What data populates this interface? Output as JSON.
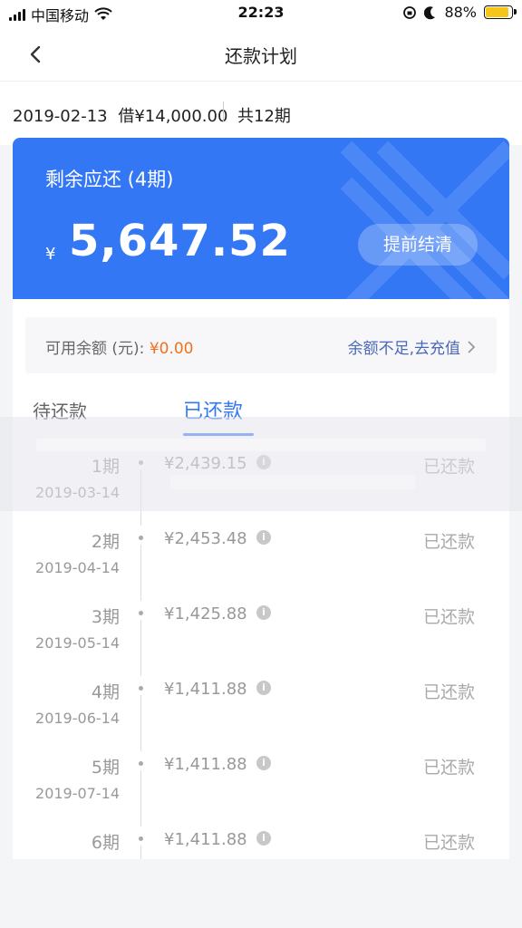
{
  "status_bar": {
    "carrier": "中国移动",
    "time": "22:23",
    "battery": "88%",
    "battery_level": 0.88,
    "icons": [
      "signal-icon",
      "wifi-icon",
      "rotation-lock-icon",
      "moon-icon",
      "battery-icon"
    ]
  },
  "nav": {
    "title": "还款计划",
    "back_icon": "chevron-left-icon"
  },
  "loan": {
    "date": "2019-02-13",
    "borrow": "借¥14,000.00",
    "total_periods": "共12期"
  },
  "card": {
    "remaining_label": "剩余应还 (4期)",
    "currency": "¥",
    "amount": "5,647.52",
    "prepay_button": "提前结清",
    "color": "#3477f5"
  },
  "balance": {
    "label": "可用余额 (元):",
    "value": "¥0.00",
    "link": "余额不足,去充值"
  },
  "tabs": {
    "pending": "待还款",
    "paid": "已还款"
  },
  "rows": [
    {
      "period": "1期",
      "date": "2019-03-14",
      "amount": "¥2,439.15",
      "status": "已还款"
    },
    {
      "period": "2期",
      "date": "2019-04-14",
      "amount": "¥2,453.48",
      "status": "已还款"
    },
    {
      "period": "3期",
      "date": "2019-05-14",
      "amount": "¥1,425.88",
      "status": "已还款"
    },
    {
      "period": "4期",
      "date": "2019-06-14",
      "amount": "¥1,411.88",
      "status": "已还款"
    },
    {
      "period": "5期",
      "date": "2019-07-14",
      "amount": "¥1,411.88",
      "status": "已还款"
    },
    {
      "period": "6期",
      "date": "",
      "amount": "¥1,411.88",
      "status": "已还款"
    }
  ]
}
